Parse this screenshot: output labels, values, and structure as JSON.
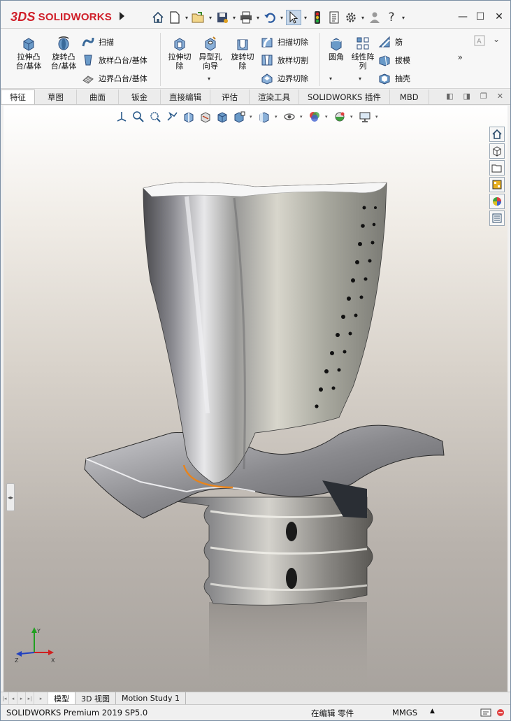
{
  "app": {
    "brand_prefix": "3DS",
    "brand_name": "SOLIDWORKS"
  },
  "quick_access": {
    "icons": [
      "home-icon",
      "new-document-icon",
      "open-icon",
      "save-icon",
      "print-icon",
      "undo-icon",
      "select-pointer-icon",
      "rebuild-traffic-light-icon",
      "file-properties-icon",
      "options-gear-icon",
      "user-icon",
      "help-icon"
    ]
  },
  "window_controls": {
    "minimize": "—",
    "maximize": "☐",
    "close": "✕"
  },
  "ribbon": {
    "extrude_boss": "拉伸凸台/基体",
    "extrude_boss_l1": "拉伸凸",
    "extrude_boss_l2": "台/基体",
    "revolve_boss_l1": "旋转凸",
    "revolve_boss_l2": "台/基体",
    "sweep": "扫描",
    "loft_boss": "放样凸台/基体",
    "boundary_boss": "边界凸台/基体",
    "extrude_cut_l1": "拉伸切",
    "extrude_cut_l2": "除",
    "hole_wizard_l1": "异型孔",
    "hole_wizard_l2": "向导",
    "revolve_cut_l1": "旋转切",
    "revolve_cut_l2": "除",
    "swept_cut": "扫描切除",
    "lofted_cut": "放样切割",
    "boundary_cut": "边界切除",
    "fillet": "圆角",
    "linear_pattern_l1": "线性阵",
    "linear_pattern_l2": "列",
    "rib": "筋",
    "draft": "拔模",
    "shell": "抽壳",
    "more": "»",
    "collapse": "⌄"
  },
  "tabs": [
    "特征",
    "草图",
    "曲面",
    "钣金",
    "直接编辑",
    "评估",
    "渲染工具",
    "SOLIDWORKS 插件",
    "MBD"
  ],
  "bottom_tabs": [
    "模型",
    "3D 视图",
    "Motion Study 1"
  ],
  "status": {
    "product": "SOLIDWORKS Premium 2019 SP5.0",
    "editing": "在编辑 零件",
    "units": "MMGS",
    "units_caret": "▲"
  },
  "colors": {
    "brand_red": "#d0202a",
    "ribbon_bg": "#f7f7f7",
    "viewport_top": "#ffffff",
    "viewport_bottom": "#a8a39e",
    "highlight_edge": "#e8841c"
  }
}
